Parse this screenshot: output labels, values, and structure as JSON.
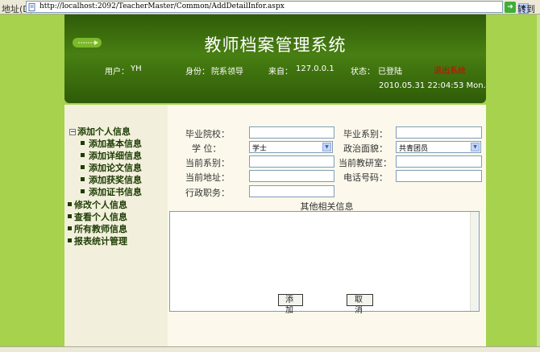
{
  "address_bar": {
    "label": "地址(D)",
    "url": "http://localhost:2092/TeacherMaster/Common/AddDetailInfor.aspx",
    "go_label": "转到"
  },
  "header": {
    "title": "教师档案管理系统",
    "user_label": "用户：",
    "user_value": "YH",
    "role_label": "身份：",
    "role_value": "院系领导",
    "from_label": "来自：",
    "from_value": "127.0.0.1",
    "status_label": "状态：",
    "status_value": "已登陆",
    "logout_label": "退出系统",
    "datetime": "2010.05.31  22:04:53  Mon."
  },
  "nav": {
    "groups": [
      {
        "label": "添加个人信息",
        "expanded": true
      },
      {
        "label": "修改个人信息"
      },
      {
        "label": "查看个人信息"
      },
      {
        "label": "所有教师信息"
      },
      {
        "label": "报表统计管理"
      }
    ],
    "subitems": [
      "添加基本信息",
      "添加详细信息",
      "添加论文信息",
      "添加获奖信息",
      "添加证书信息"
    ],
    "expand_symbol": "−"
  },
  "form": {
    "grad_school_label": "毕业院校：",
    "grad_dept_label": "毕业系别：",
    "degree_label": "学  位：",
    "degree_value": "学士",
    "political_label": "政治面貌：",
    "political_value": "共青团员",
    "cur_dept_label": "当前系别：",
    "cur_office_label": "当前教研室：",
    "cur_address_label": "当前地址：",
    "phone_label": "电话号码：",
    "admin_post_label": "行政职务：",
    "other_info_title": "其他相关信息",
    "add_button": "添 加",
    "cancel_button": "取 消"
  },
  "colors": {
    "header_green": "#3a6a0c",
    "page_green": "#a6d24d",
    "logout_red": "#d80000",
    "nav_text": "#1e3d05"
  }
}
